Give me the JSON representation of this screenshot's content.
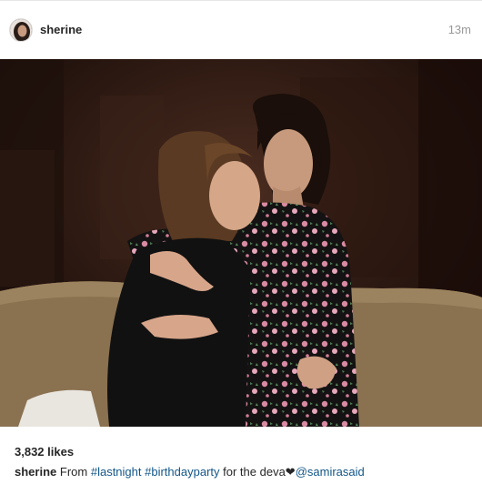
{
  "post": {
    "username": "sherine",
    "time_ago": "13m",
    "likes": "3,832 likes",
    "caption": {
      "author": "sherine",
      "text_before": "From",
      "hashtag_1": "#lastnight",
      "hashtag_2": "#birthdayparty",
      "text_after": "for the deva",
      "heart": "❤",
      "mention": "@samirasaid"
    }
  },
  "icons": {
    "avatar": "profile-photo",
    "heart": "heart-glyph"
  },
  "colors": {
    "link": "#125688",
    "meta": "#999999",
    "text": "#262626"
  }
}
